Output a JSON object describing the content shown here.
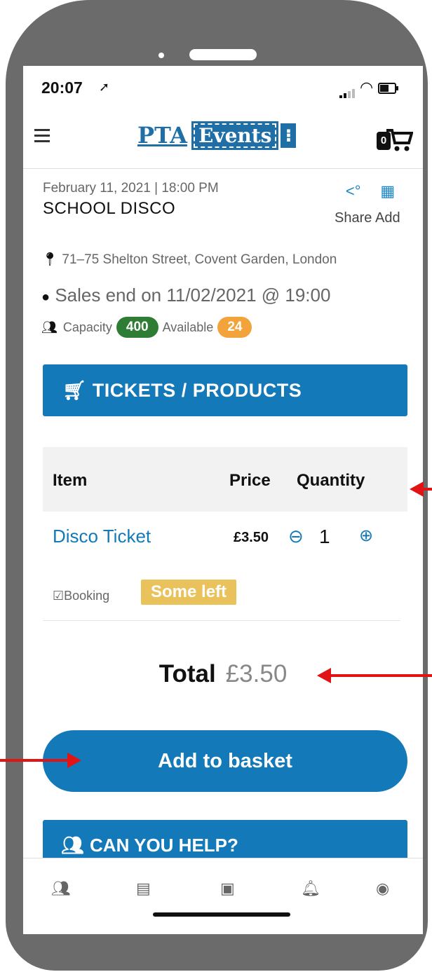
{
  "status_bar": {
    "time": "20:07",
    "location_icon": "location-arrow-icon",
    "signal_icon": "signal-icon",
    "wifi_icon": "wifi-icon",
    "battery_icon": "battery-icon"
  },
  "header": {
    "logo_pta": "PTA",
    "logo_events": "Events",
    "cart_count": "0"
  },
  "event": {
    "date": "February 11, 2021 | 18:00 PM",
    "title": "SCHOOL DISCO",
    "share_label": "Share",
    "add_label": "Add",
    "address": "71–75 Shelton Street, Covent Garden, London",
    "sales_end": "Sales end on 11/02/2021 @ 19:00",
    "capacity_label": "Capacity",
    "capacity_value": "400",
    "available_label": "Available",
    "available_value": "24"
  },
  "tickets": {
    "section_title": "TICKETS / PRODUCTS",
    "columns": [
      "Item",
      "Price",
      "Quantity"
    ],
    "rows": [
      {
        "item": "Disco Ticket",
        "price": "£3.50",
        "quantity": "1",
        "type": "Booking",
        "stock": "Some left"
      }
    ]
  },
  "total": {
    "label": "Total",
    "amount": "£3.50"
  },
  "add_to_basket": "Add to basket",
  "help_section": "CAN YOU HELP?",
  "tabbar": {
    "items": [
      "community-icon",
      "news-icon",
      "calendar-icon",
      "bell-icon",
      "profile-icon"
    ]
  },
  "colors": {
    "brand_blue": "#1379b8",
    "capacity_green": "#2f7d34",
    "available_orange": "#f2a33a",
    "stock_yellow": "#e9c25c",
    "annotation_red": "#e01414",
    "phone_frame": "#6b6b6b"
  }
}
